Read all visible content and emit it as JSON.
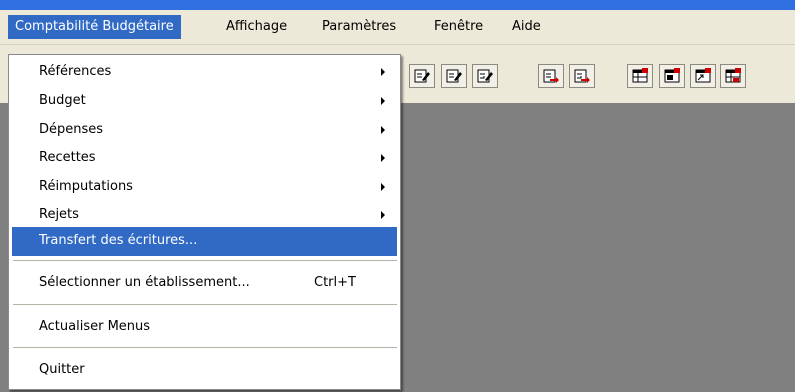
{
  "menubar": {
    "items": [
      {
        "label": "Comptabilité Budgétaire",
        "active": true
      },
      {
        "label": "Affichage"
      },
      {
        "label": "Paramètres"
      },
      {
        "label": "Fenêtre"
      },
      {
        "label": "Aide"
      }
    ]
  },
  "dropdown": {
    "items": [
      {
        "label": "Références",
        "submenu": true
      },
      {
        "label": "Budget",
        "submenu": true
      },
      {
        "label": "Dépenses",
        "submenu": true
      },
      {
        "label": "Recettes",
        "submenu": true
      },
      {
        "label": "Réimputations",
        "submenu": true
      },
      {
        "label": "Rejets",
        "submenu": true
      },
      {
        "label": "Transfert des écritures...",
        "highlighted": true
      },
      {
        "label": "Sélectionner un établissement...",
        "shortcut": "Ctrl+T"
      },
      {
        "label": "Actualiser Menus"
      },
      {
        "label": "Quitter"
      }
    ]
  },
  "toolbar": {
    "icons": [
      "document-edit-icon",
      "document-edit-icon",
      "document-edit-icon",
      "document-arrow-icon",
      "document-arrow-icon",
      "grid-icon",
      "grid-icon",
      "grid-icon",
      "grid-icon"
    ]
  },
  "colors": {
    "highlight": "#316ac5",
    "menubar_bg": "#ece9d8",
    "workspace_bg": "#808080",
    "title_strip": "#2f6fe0"
  }
}
